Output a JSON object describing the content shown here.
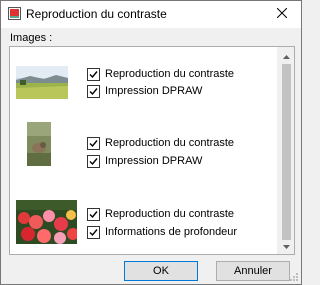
{
  "window": {
    "title": "Reproduction du contraste"
  },
  "section": {
    "label": "Images :"
  },
  "items": [
    {
      "thumbnail": "landscape-field-image",
      "options": [
        {
          "label": "Reproduction du contraste",
          "checked": true
        },
        {
          "label": "Impression DPRAW",
          "checked": true
        }
      ]
    },
    {
      "thumbnail": "bird-photo-image",
      "options": [
        {
          "label": "Reproduction du contraste",
          "checked": true
        },
        {
          "label": "Impression DPRAW",
          "checked": true
        }
      ]
    },
    {
      "thumbnail": "flowers-photo-image",
      "options": [
        {
          "label": "Reproduction du contraste",
          "checked": true
        },
        {
          "label": "Informations de profondeur",
          "checked": true
        }
      ]
    }
  ],
  "buttons": {
    "ok": "OK",
    "cancel": "Annuler"
  },
  "colors": {
    "accent": "#0078d7",
    "background": "#f0f0f0"
  }
}
